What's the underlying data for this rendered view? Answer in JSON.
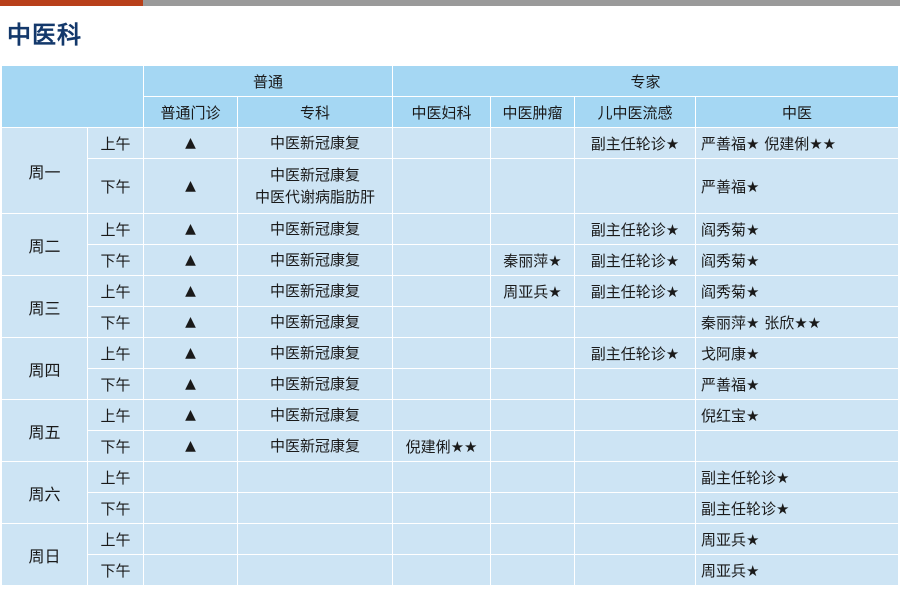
{
  "title": "中医科",
  "header": {
    "group_common": "普通",
    "group_expert": "专家",
    "columns": [
      "普通门诊",
      "专科",
      "中医妇科",
      "中医肿瘤",
      "儿中医流感",
      "中医"
    ]
  },
  "days": [
    {
      "day": "周一",
      "sessions": [
        {
          "period": "上午",
          "outpatient": "▲",
          "specialty": [
            "中医新冠康复"
          ],
          "gyn": "",
          "onco": "",
          "peds": "副主任轮诊★",
          "tcm": "严善福★  倪建俐★★"
        },
        {
          "period": "下午",
          "outpatient": "▲",
          "specialty": [
            "中医新冠康复",
            "中医代谢病脂肪肝"
          ],
          "gyn": "",
          "onco": "",
          "peds": "",
          "tcm": "严善福★"
        }
      ]
    },
    {
      "day": "周二",
      "sessions": [
        {
          "period": "上午",
          "outpatient": "▲",
          "specialty": [
            "中医新冠康复"
          ],
          "gyn": "",
          "onco": "",
          "peds": "副主任轮诊★",
          "tcm": "阎秀菊★"
        },
        {
          "period": "下午",
          "outpatient": "▲",
          "specialty": [
            "中医新冠康复"
          ],
          "gyn": "",
          "onco": "秦丽萍★",
          "peds": "副主任轮诊★",
          "tcm": "阎秀菊★"
        }
      ]
    },
    {
      "day": "周三",
      "sessions": [
        {
          "period": "上午",
          "outpatient": "▲",
          "specialty": [
            "中医新冠康复"
          ],
          "gyn": "",
          "onco": "周亚兵★",
          "peds": "副主任轮诊★",
          "tcm": "阎秀菊★"
        },
        {
          "period": "下午",
          "outpatient": "▲",
          "specialty": [
            "中医新冠康复"
          ],
          "gyn": "",
          "onco": "",
          "peds": "",
          "tcm": "秦丽萍★  张欣★★"
        }
      ]
    },
    {
      "day": "周四",
      "sessions": [
        {
          "period": "上午",
          "outpatient": "▲",
          "specialty": [
            "中医新冠康复"
          ],
          "gyn": "",
          "onco": "",
          "peds": "副主任轮诊★",
          "tcm": "戈阿康★"
        },
        {
          "period": "下午",
          "outpatient": "▲",
          "specialty": [
            "中医新冠康复"
          ],
          "gyn": "",
          "onco": "",
          "peds": "",
          "tcm": "严善福★"
        }
      ]
    },
    {
      "day": "周五",
      "sessions": [
        {
          "period": "上午",
          "outpatient": "▲",
          "specialty": [
            "中医新冠康复"
          ],
          "gyn": "",
          "onco": "",
          "peds": "",
          "tcm": "倪红宝★"
        },
        {
          "period": "下午",
          "outpatient": "▲",
          "specialty": [
            "中医新冠康复"
          ],
          "gyn": "倪建俐★★",
          "onco": "",
          "peds": "",
          "tcm": ""
        }
      ]
    },
    {
      "day": "周六",
      "sessions": [
        {
          "period": "上午",
          "outpatient": "",
          "specialty": [],
          "gyn": "",
          "onco": "",
          "peds": "",
          "tcm": "副主任轮诊★"
        },
        {
          "period": "下午",
          "outpatient": "",
          "specialty": [],
          "gyn": "",
          "onco": "",
          "peds": "",
          "tcm": "副主任轮诊★"
        }
      ]
    },
    {
      "day": "周日",
      "sessions": [
        {
          "period": "上午",
          "outpatient": "",
          "specialty": [],
          "gyn": "",
          "onco": "",
          "peds": "",
          "tcm": "周亚兵★"
        },
        {
          "period": "下午",
          "outpatient": "",
          "specialty": [],
          "gyn": "",
          "onco": "",
          "peds": "",
          "tcm": "周亚兵★"
        }
      ]
    }
  ]
}
